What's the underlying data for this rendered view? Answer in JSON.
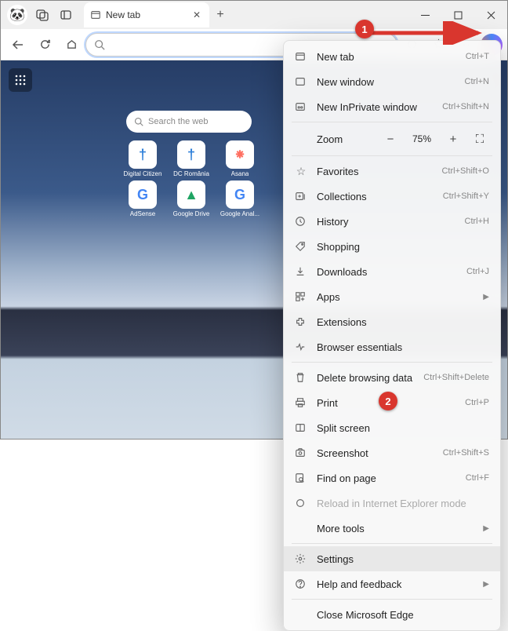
{
  "tab": {
    "title": "New tab"
  },
  "search": {
    "placeholder": "Search the web"
  },
  "tiles": [
    {
      "letter": "†",
      "color": "#2d7fd9",
      "label": "Digital Citizen"
    },
    {
      "letter": "†",
      "color": "#2d7fd9",
      "label": "DC România"
    },
    {
      "letter": "⁕",
      "color": "#ff6f61",
      "label": "Asana"
    },
    {
      "letter": "G",
      "color": "#4285f4",
      "label": "AdSense"
    },
    {
      "letter": "▲",
      "color": "#1fa463",
      "label": "Google Drive"
    },
    {
      "letter": "G",
      "color": "#4285f4",
      "label": "Google Anal..."
    }
  ],
  "zoom": {
    "label": "Zoom",
    "value": "75%"
  },
  "menu": {
    "newTab": {
      "label": "New tab",
      "shortcut": "Ctrl+T"
    },
    "newWin": {
      "label": "New window",
      "shortcut": "Ctrl+N"
    },
    "newPriv": {
      "label": "New InPrivate window",
      "shortcut": "Ctrl+Shift+N"
    },
    "fav": {
      "label": "Favorites",
      "shortcut": "Ctrl+Shift+O"
    },
    "coll": {
      "label": "Collections",
      "shortcut": "Ctrl+Shift+Y"
    },
    "hist": {
      "label": "History",
      "shortcut": "Ctrl+H"
    },
    "shop": {
      "label": "Shopping",
      "shortcut": ""
    },
    "down": {
      "label": "Downloads",
      "shortcut": "Ctrl+J"
    },
    "apps": {
      "label": "Apps",
      "shortcut": ""
    },
    "ext": {
      "label": "Extensions",
      "shortcut": ""
    },
    "ess": {
      "label": "Browser essentials",
      "shortcut": ""
    },
    "del": {
      "label": "Delete browsing data",
      "shortcut": "Ctrl+Shift+Delete"
    },
    "print": {
      "label": "Print",
      "shortcut": "Ctrl+P"
    },
    "split": {
      "label": "Split screen",
      "shortcut": ""
    },
    "shot": {
      "label": "Screenshot",
      "shortcut": "Ctrl+Shift+S"
    },
    "find": {
      "label": "Find on page",
      "shortcut": "Ctrl+F"
    },
    "reload": {
      "label": "Reload in Internet Explorer mode",
      "shortcut": ""
    },
    "tools": {
      "label": "More tools",
      "shortcut": ""
    },
    "settings": {
      "label": "Settings",
      "shortcut": ""
    },
    "help": {
      "label": "Help and feedback",
      "shortcut": ""
    },
    "close": {
      "label": "Close Microsoft Edge",
      "shortcut": ""
    }
  },
  "callouts": {
    "one": "1",
    "two": "2"
  }
}
